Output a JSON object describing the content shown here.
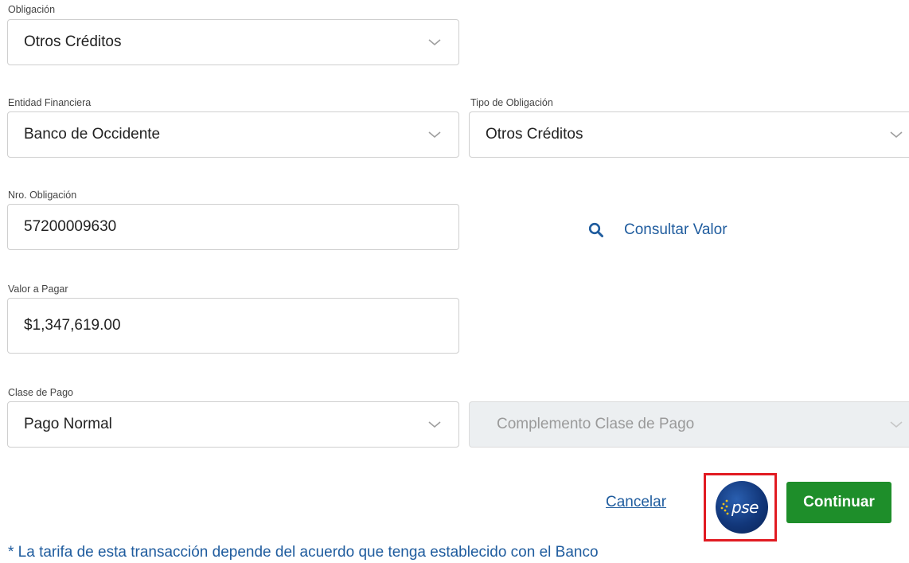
{
  "obligacion": {
    "label": "Obligación",
    "value": "Otros Créditos"
  },
  "entidad": {
    "label": "Entidad Financiera",
    "value": "Banco de Occidente"
  },
  "tipo": {
    "label": "Tipo de Obligación",
    "value": "Otros Créditos"
  },
  "nro": {
    "label": "Nro. Obligación",
    "value": "57200009630"
  },
  "consultar": {
    "label": "Consultar Valor",
    "icon": "search-icon"
  },
  "valor": {
    "label": "Valor a Pagar",
    "value": "$1,347,619.00"
  },
  "clase": {
    "label": "Clase de Pago",
    "value": "Pago Normal",
    "complemento_placeholder": "Complemento Clase de Pago"
  },
  "actions": {
    "cancel_label": "Cancelar",
    "pse_logo_text": "pse",
    "continue_label": "Continuar"
  },
  "note": "* La tarifa de esta transacción depende del acuerdo que tenga establecido con el Banco",
  "colors": {
    "link": "#1f5c9e",
    "primary_button": "#1e8e2a",
    "highlight_frame": "#e11b22",
    "disabled_field": "#eceff1"
  }
}
